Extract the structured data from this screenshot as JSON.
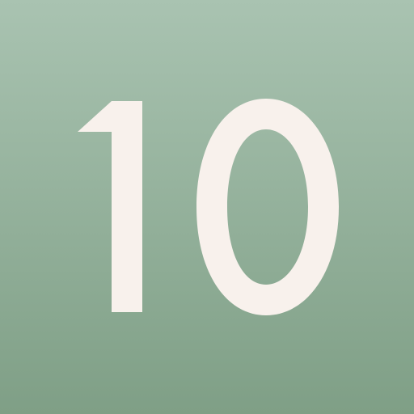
{
  "tile": {
    "number": "10",
    "background_top_color": "#a9c3b1",
    "background_bottom_color": "#7f9f86",
    "number_color": "#f8f1ec"
  }
}
